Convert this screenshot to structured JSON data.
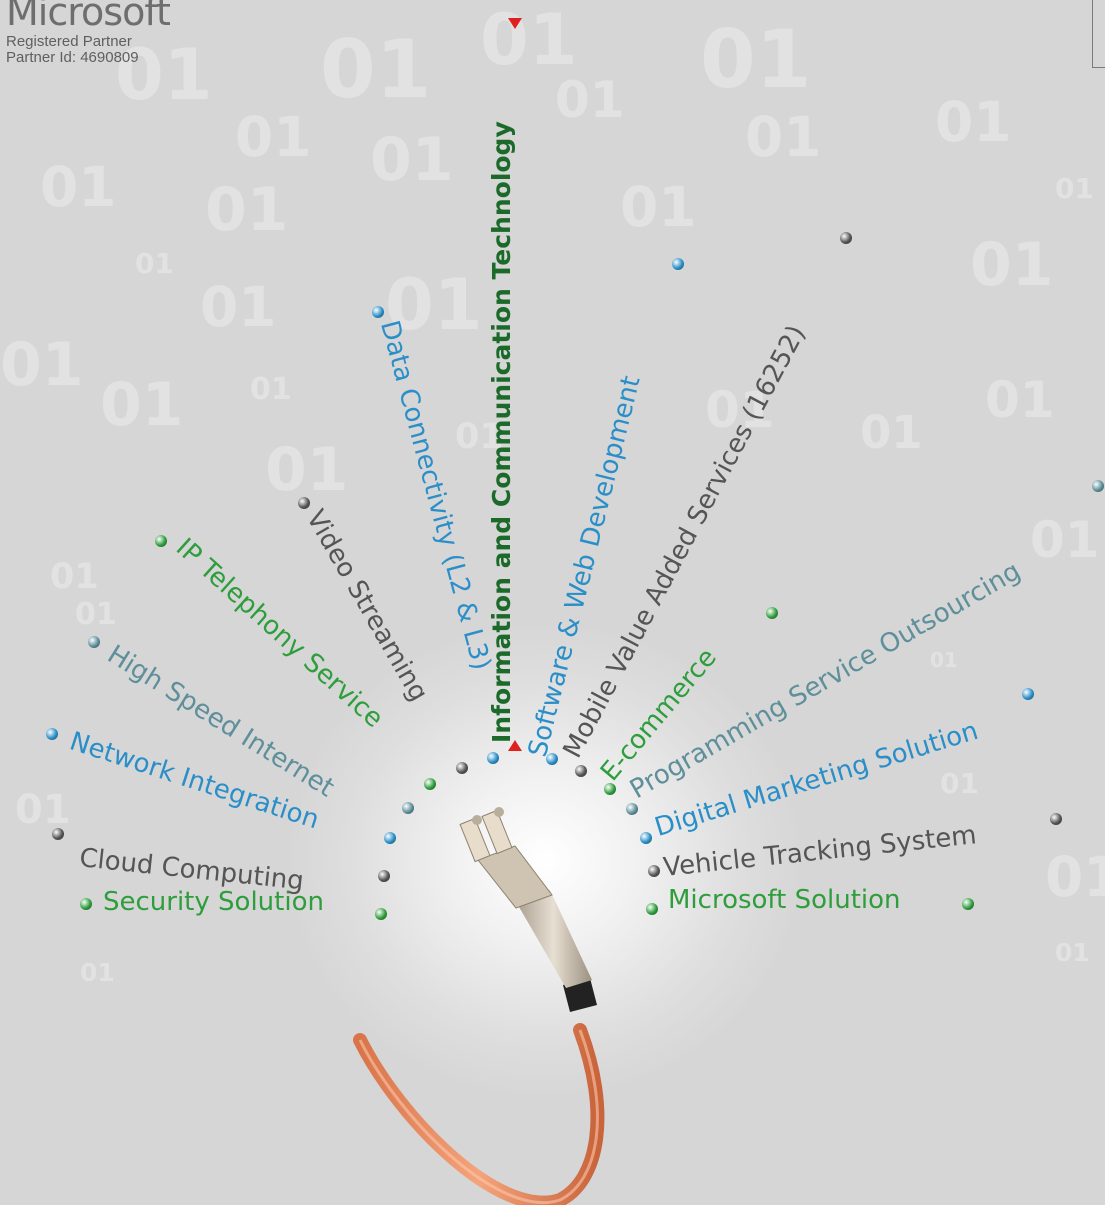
{
  "brand": {
    "name": "Microsoft",
    "line1": "Registered Partner",
    "line2": "Partner Id: 4690809"
  },
  "center_title": "Information and Communication Technology",
  "colors": {
    "green": "#2e9e3c",
    "blue": "#2a8fc9",
    "gray": "#555555",
    "teal": "#5e8f9a",
    "dark_green": "#1c6a2a",
    "red": "#e02020"
  },
  "services": [
    {
      "label": "Security Solution",
      "color": "green"
    },
    {
      "label": "Cloud Computing",
      "color": "gray"
    },
    {
      "label": "Network Integration",
      "color": "blue"
    },
    {
      "label": "High Speed Internet",
      "color": "teal"
    },
    {
      "label": "IP Telephony Service",
      "color": "green"
    },
    {
      "label": "Video Streaming",
      "color": "gray"
    },
    {
      "label": "Data Connectivity (L2 & L3)",
      "color": "blue"
    },
    {
      "label": "Software & Web Development",
      "color": "blue"
    },
    {
      "label": "Mobile Value Added Services (16252)",
      "color": "gray"
    },
    {
      "label": "E-commerce",
      "color": "green"
    },
    {
      "label": "Programming Service Outsourcing",
      "color": "teal"
    },
    {
      "label": "Digital Marketing Solution",
      "color": "blue"
    },
    {
      "label": "Vehicle Tracking System",
      "color": "gray"
    },
    {
      "label": "Microsoft Solution",
      "color": "green"
    }
  ],
  "background_digits": "01",
  "icons": {
    "bullet": "bullet-dot-icon",
    "marker": "triangle-marker-icon",
    "cable": "fiber-optic-cable-icon"
  }
}
